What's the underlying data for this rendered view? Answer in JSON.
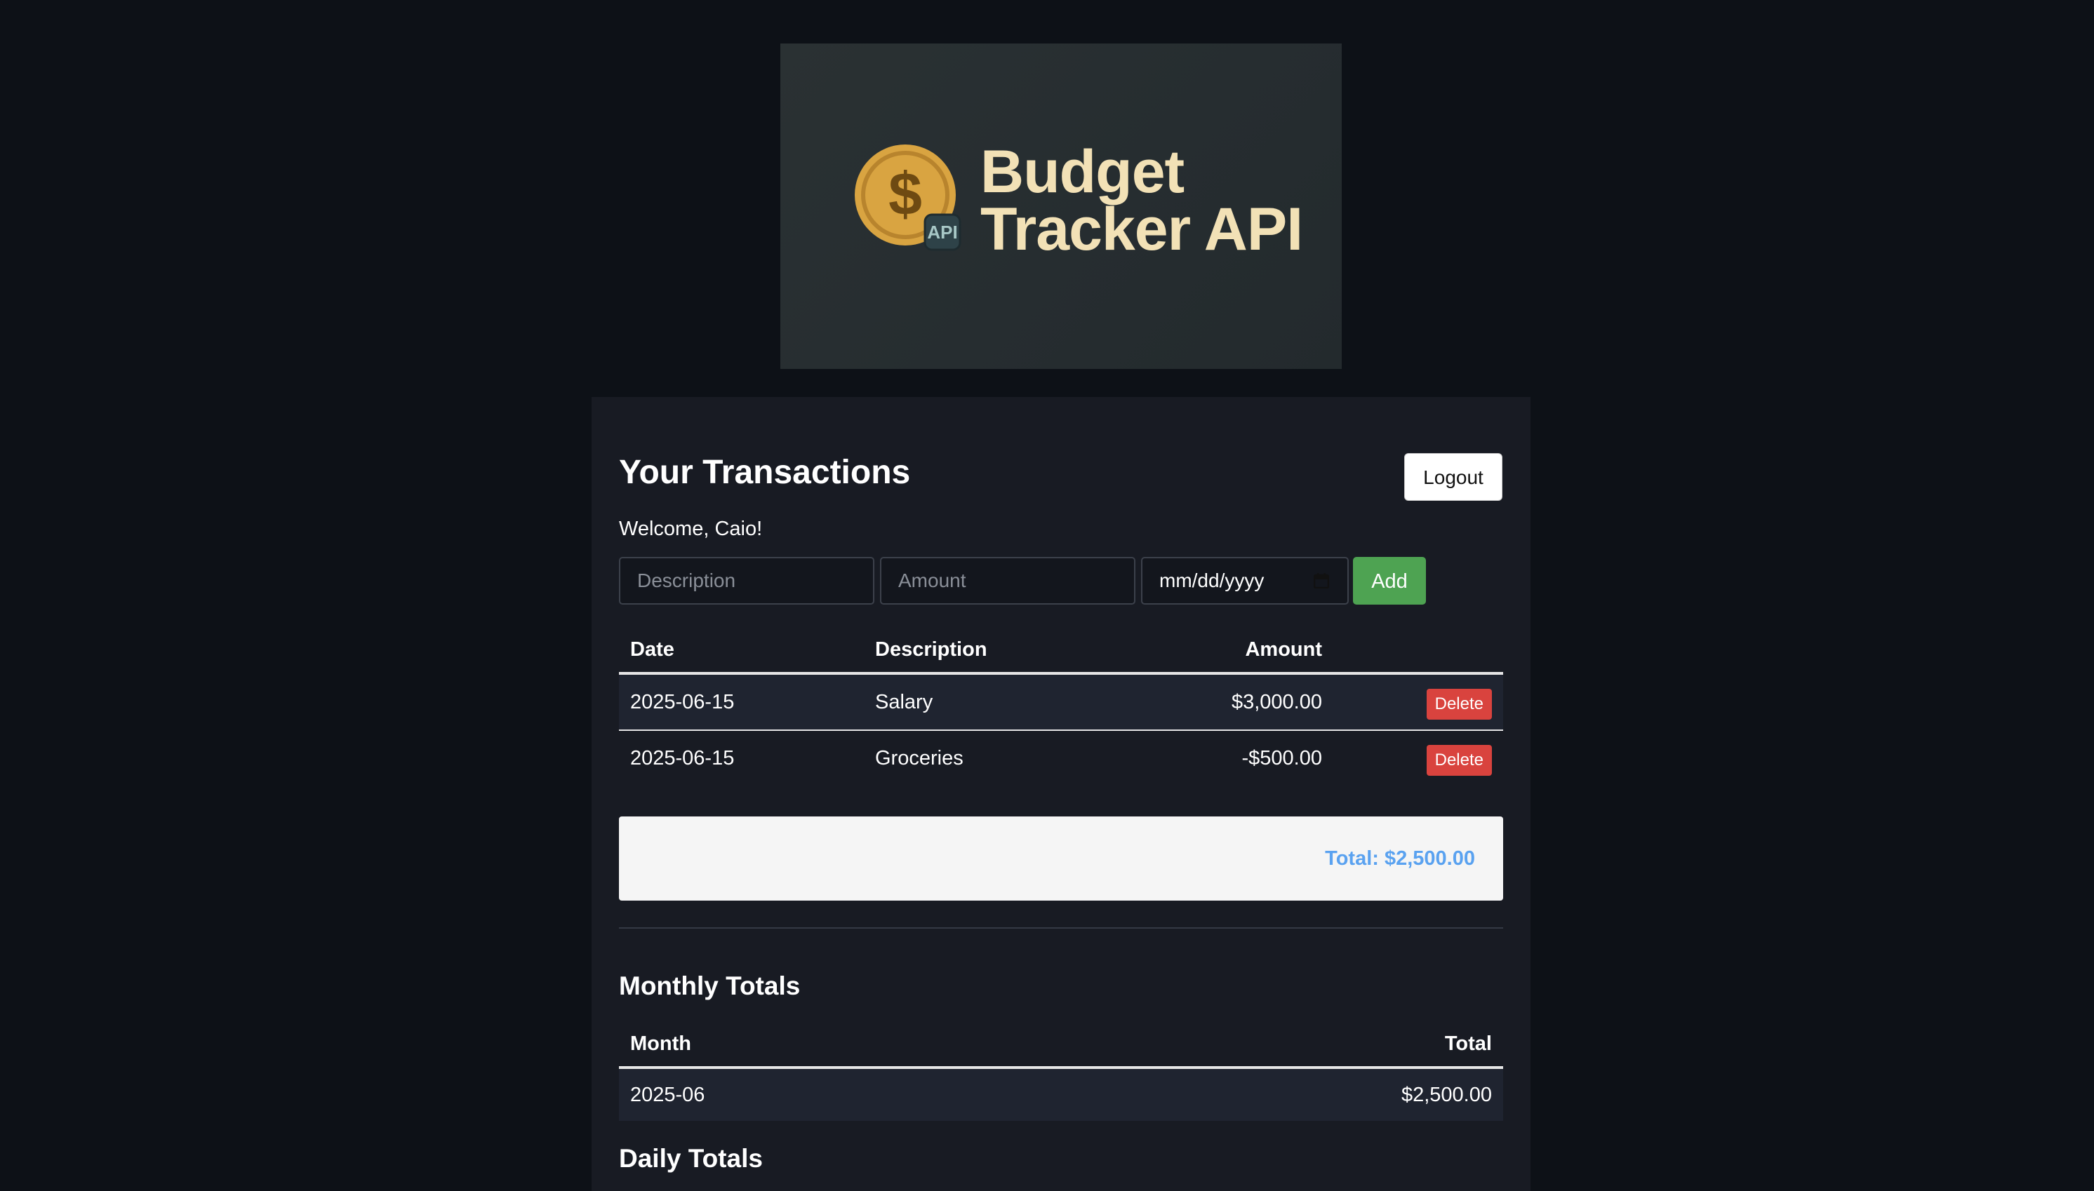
{
  "logo": {
    "title_line1": "Budget",
    "title_line2": "Tracker API",
    "badge_text": "API",
    "coin_symbol": "$",
    "colors": {
      "banner": "#262d30",
      "coin": "#d9a441",
      "text": "#f2e1b6"
    }
  },
  "header": {
    "title": "Your Transactions",
    "logout_label": "Logout",
    "welcome": "Welcome, Caio!"
  },
  "form": {
    "description_placeholder": "Description",
    "amount_placeholder": "Amount",
    "date_placeholder": "mm/dd/yyyy",
    "add_label": "Add"
  },
  "transactions": {
    "columns": [
      "Date",
      "Description",
      "Amount"
    ],
    "rows": [
      {
        "date": "2025-06-15",
        "description": "Salary",
        "amount": "$3,000.00",
        "action": "Delete"
      },
      {
        "date": "2025-06-15",
        "description": "Groceries",
        "amount": "-$500.00",
        "action": "Delete"
      }
    ],
    "total": "Total: $2,500.00"
  },
  "monthly": {
    "title": "Monthly Totals",
    "columns": [
      "Month",
      "Total"
    ],
    "rows": [
      {
        "month": "2025-06",
        "total": "$2,500.00"
      }
    ]
  },
  "daily": {
    "title": "Daily Totals"
  },
  "colors": {
    "page_background": "#0d1117",
    "panel_background": "#181b23",
    "add_button": "#4ea352",
    "delete_button": "#d9433e",
    "total_text": "#5aa2f0",
    "striped_row": "#1f2430"
  }
}
